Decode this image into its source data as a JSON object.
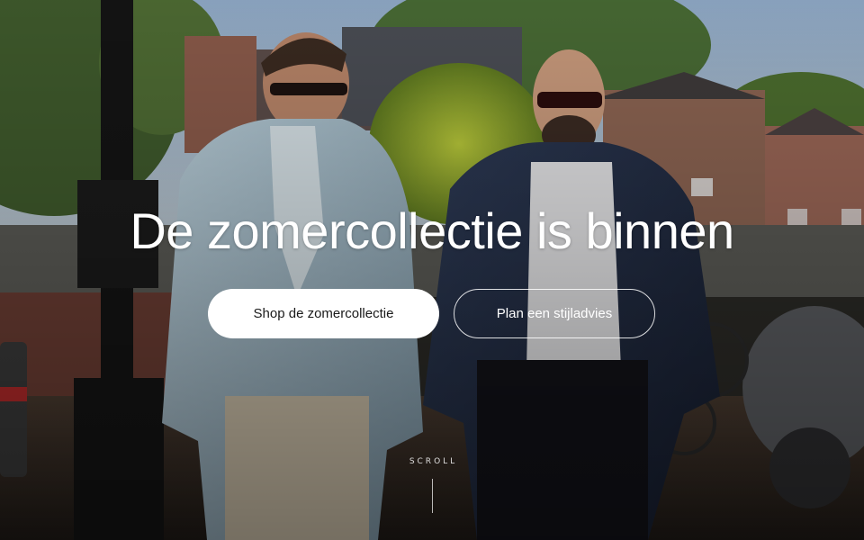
{
  "hero": {
    "title": "De zomercollectie is binnen",
    "primary_cta": "Shop de zomercollectie",
    "secondary_cta": "Plan een stijladvies",
    "scroll_label": "SCROLL"
  },
  "colors": {
    "primary_button_bg": "#ffffff",
    "primary_button_text": "#1a1a1a",
    "secondary_button_border": "#ffffff",
    "title_text": "#ffffff"
  },
  "background": {
    "description_icon": "photo-two-men-walking-canal-street"
  }
}
